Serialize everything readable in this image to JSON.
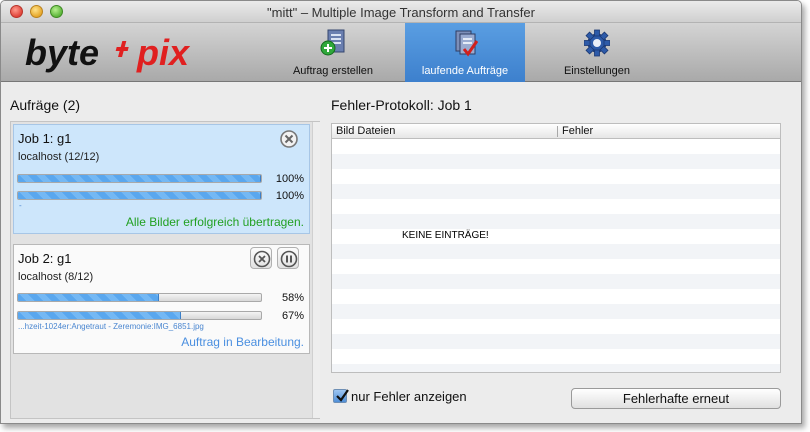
{
  "window": {
    "title": "\"mitt\" – Multiple Image Transform and Transfer"
  },
  "logo": {
    "part1": "byte",
    "part2": "pix"
  },
  "toolbar": {
    "items": [
      {
        "label": "Auftrag erstellen",
        "icon": "add-document-icon",
        "active": false
      },
      {
        "label": "laufende Aufträge",
        "icon": "running-jobs-icon",
        "active": true
      },
      {
        "label": "Einstellungen",
        "icon": "gear-icon",
        "active": false
      }
    ]
  },
  "jobs_panel": {
    "title": "Aufräge (2)",
    "jobs": [
      {
        "title": "Job 1: g1",
        "host": "localhost (12/12)",
        "progress": [
          100,
          100
        ],
        "progress_labels": [
          "100%",
          "100%"
        ],
        "file": "-",
        "status": "Alle Bilder erfolgreich übertragen.",
        "status_color": "#22a022",
        "selected": true
      },
      {
        "title": "Job 2: g1",
        "host": "localhost (8/12)",
        "progress": [
          58,
          67
        ],
        "progress_labels": [
          "58%",
          "67%"
        ],
        "file": "...hzeit-1024er:Angetraut - Zeremonie:IMG_6851.jpg",
        "status": "Auftrag in Bearbeitung.",
        "status_color": "#4a8fe0",
        "selected": false
      }
    ]
  },
  "log_panel": {
    "title": "Fehler-Protokoll: Job 1",
    "columns": [
      "Bild Dateien",
      "Fehler"
    ],
    "empty_message": "KEINE EINTRÄGE!",
    "only_errors_label": "nur Fehler anzeigen",
    "only_errors_checked": true,
    "retry_button": "Fehlerhafte erneut"
  },
  "colors": {
    "accent": "#3d80cd",
    "logo_dark": "#111111",
    "logo_red": "#e02020"
  }
}
